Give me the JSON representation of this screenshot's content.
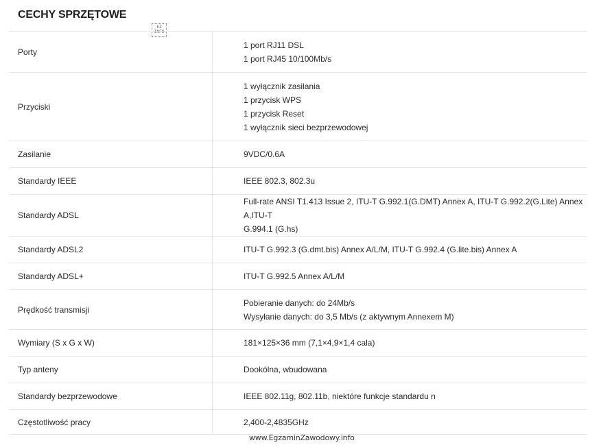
{
  "title": "CECHY SPRZĘTOWE",
  "logo_text": "EZ INFO",
  "rows": [
    {
      "label": "Porty",
      "values": [
        "1 port RJ11 DSL",
        "1 port RJ45 10/100Mb/s"
      ]
    },
    {
      "label": "Przyciski",
      "values": [
        "1 wyłącznik zasilania",
        "1 przycisk WPS",
        "1 przycisk Reset",
        "1 wyłącznik sieci bezprzewodowej"
      ]
    },
    {
      "label": "Zasilanie",
      "values": [
        "9VDC/0.6A"
      ]
    },
    {
      "label": "Standardy IEEE",
      "values": [
        "IEEE 802.3, 802.3u"
      ]
    },
    {
      "label": "Standardy ADSL",
      "values": [
        "Full-rate ANSI T1.413 Issue 2, ITU-T G.992.1(G.DMT) Annex A, ITU-T G.992.2(G.Lite) Annex A,ITU-T",
        "G.994.1 (G.hs)"
      ]
    },
    {
      "label": "Standardy ADSL2",
      "values": [
        "ITU-T G.992.3 (G.dmt.bis) Annex A/L/M, ITU-T G.992.4 (G.lite.bis) Annex A"
      ]
    },
    {
      "label": "Standardy ADSL+",
      "values": [
        "ITU-T G.992.5 Annex A/L/M"
      ]
    },
    {
      "label": "Prędkość transmisji",
      "values": [
        "Pobieranie danych: do 24Mb/s",
        "Wysyłanie danych: do 3,5 Mb/s (z aktywnym Annexem M)"
      ]
    },
    {
      "label": "Wymiary (S x G x W)",
      "values": [
        "181×125×36 mm (7,1×4,9×1,4 cala)"
      ]
    },
    {
      "label": "Typ anteny",
      "values": [
        "Dookólna, wbudowana"
      ]
    },
    {
      "label": "Standardy bezprzewodowe",
      "values": [
        "IEEE 802.11g, 802.11b, niektóre funkcje standardu n"
      ]
    },
    {
      "label": "Częstotliwość pracy",
      "values": [
        "2,400-2,4835GHz"
      ]
    }
  ],
  "watermark": "www.EgzaminZawodowy.info"
}
